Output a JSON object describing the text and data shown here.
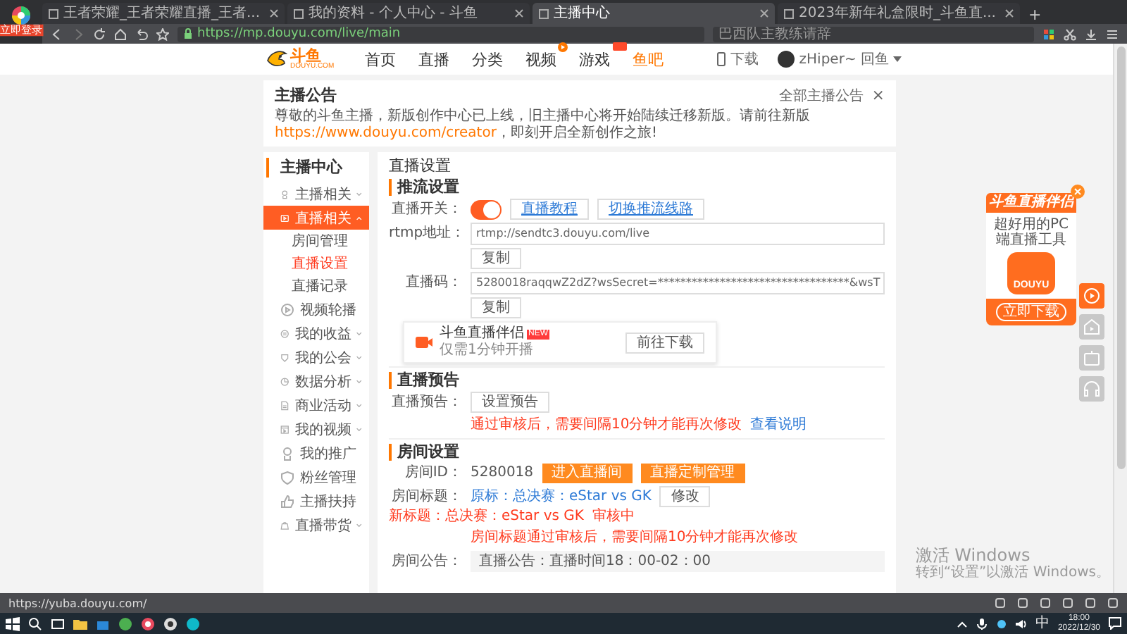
{
  "browser": {
    "logo_label": "立即登录",
    "tabs": [
      {
        "title": "王者荣耀_王者荣耀直播_王者...",
        "selected": false
      },
      {
        "title": "我的资料 - 个人中心 - 斗鱼",
        "selected": false
      },
      {
        "title": "主播中心",
        "selected": true
      },
      {
        "title": "2023年新年礼盒限时_斗鱼直...",
        "selected": false
      }
    ],
    "new_tab": "+",
    "url": "https://mp.douyu.com/live/main",
    "search_placeholder": "巴西队主教练请辞"
  },
  "site_header": {
    "logo": "斗鱼",
    "logo_sub": "DOUYU.COM",
    "nav": [
      {
        "label": "首页",
        "selected": false,
        "dot": false,
        "tag": false
      },
      {
        "label": "直播",
        "selected": false,
        "dot": false,
        "tag": false
      },
      {
        "label": "分类",
        "selected": false,
        "dot": false,
        "tag": false
      },
      {
        "label": "视频",
        "selected": false,
        "dot": true,
        "tag": false
      },
      {
        "label": "游戏",
        "selected": false,
        "dot": false,
        "tag": true
      },
      {
        "label": "鱼吧",
        "selected": true,
        "dot": false,
        "tag": false
      }
    ],
    "download": "下载",
    "user": "zHiper~ 回鱼"
  },
  "notice": {
    "title": "主播公告",
    "all_link": "全部主播公告",
    "close": "×",
    "text_before": "尊敬的斗鱼主播，新版创作中心已上线，旧主播中心将开始陆续迁移新版。请前往新版",
    "link": "https://www.douyu.com/creator",
    "text_after": "，即刻开启全新创作之旅!"
  },
  "sidebar": {
    "title": "主播中心",
    "items": [
      {
        "label": "主播相关",
        "expandable": true,
        "expanded": false,
        "selected": false
      },
      {
        "label": "直播相关",
        "expandable": true,
        "expanded": true,
        "selected": true,
        "children": [
          {
            "label": "房间管理",
            "selected": false
          },
          {
            "label": "直播设置",
            "selected": true
          },
          {
            "label": "直播记录",
            "selected": false
          }
        ]
      },
      {
        "label": "视频轮播",
        "expandable": false,
        "selected": false
      },
      {
        "label": "我的收益",
        "expandable": true,
        "expanded": false,
        "selected": false
      },
      {
        "label": "我的公会",
        "expandable": true,
        "expanded": false,
        "selected": false
      },
      {
        "label": "数据分析",
        "expandable": true,
        "expanded": false,
        "selected": false
      },
      {
        "label": "商业活动",
        "expandable": true,
        "expanded": false,
        "selected": false
      },
      {
        "label": "我的视频",
        "expandable": true,
        "expanded": false,
        "selected": false
      },
      {
        "label": "我的推广",
        "expandable": false,
        "selected": false
      },
      {
        "label": "粉丝管理",
        "expandable": false,
        "selected": false
      },
      {
        "label": "主播扶持",
        "expandable": false,
        "selected": false
      },
      {
        "label": "直播带货",
        "expandable": true,
        "expanded": false,
        "selected": false
      }
    ]
  },
  "main": {
    "title": "直播设置",
    "stream": {
      "heading": "推流设置",
      "switch_label": "直播开关：",
      "switch_on": true,
      "buttons": [
        "直播教程",
        "切换推流线路"
      ],
      "rtmp_label": "rtmp地址：",
      "rtmp_value": "rtmp://sendtc3.douyu.com/live",
      "copy_rtmp": "复制",
      "code_label": "直播码：",
      "code_value": "5280018raqqwZ2dZ?wsSecret=**********************************&wsT",
      "copy_code": "复制",
      "promo": {
        "title": "斗鱼直播伴侣",
        "badge": "NEW",
        "subtitle": "仅需1分钟开播",
        "button": "前往下载"
      }
    },
    "preview": {
      "heading": "直播预告",
      "label": "直播预告：",
      "button": "设置预告",
      "note": "通过审核后，需要间隔10分钟才能再次修改",
      "link": "查看说明"
    },
    "room": {
      "heading": "房间设置",
      "id_label": "房间ID：",
      "id_value": "5280018",
      "id_buttons": [
        "进入直播间",
        "直播定制管理"
      ],
      "title_label": "房间标题：",
      "old_title": "原标：总决赛：eStar vs GK",
      "edit": "修改",
      "new_title": "新标题：总决赛：eStar vs GK",
      "status": "审核中",
      "note": "房间标题通过审核后，需要间隔10分钟才能再次修改",
      "announce_label": "房间公告：",
      "announce_value": "直播公告：直播时间18：00-02：00"
    }
  },
  "ad": {
    "title": "斗鱼直播伴侣",
    "subtitle": "超好用的PC端直播工具",
    "app": "DOUYU",
    "button": "立即下载"
  },
  "status_url": "https://yuba.douyu.com/",
  "activation": {
    "title": "激活 Windows",
    "subtitle": "转到“设置”以激活 Windows。"
  },
  "taskbar": {
    "ime": "中",
    "time": "18:00",
    "date": "2022/12/30"
  }
}
